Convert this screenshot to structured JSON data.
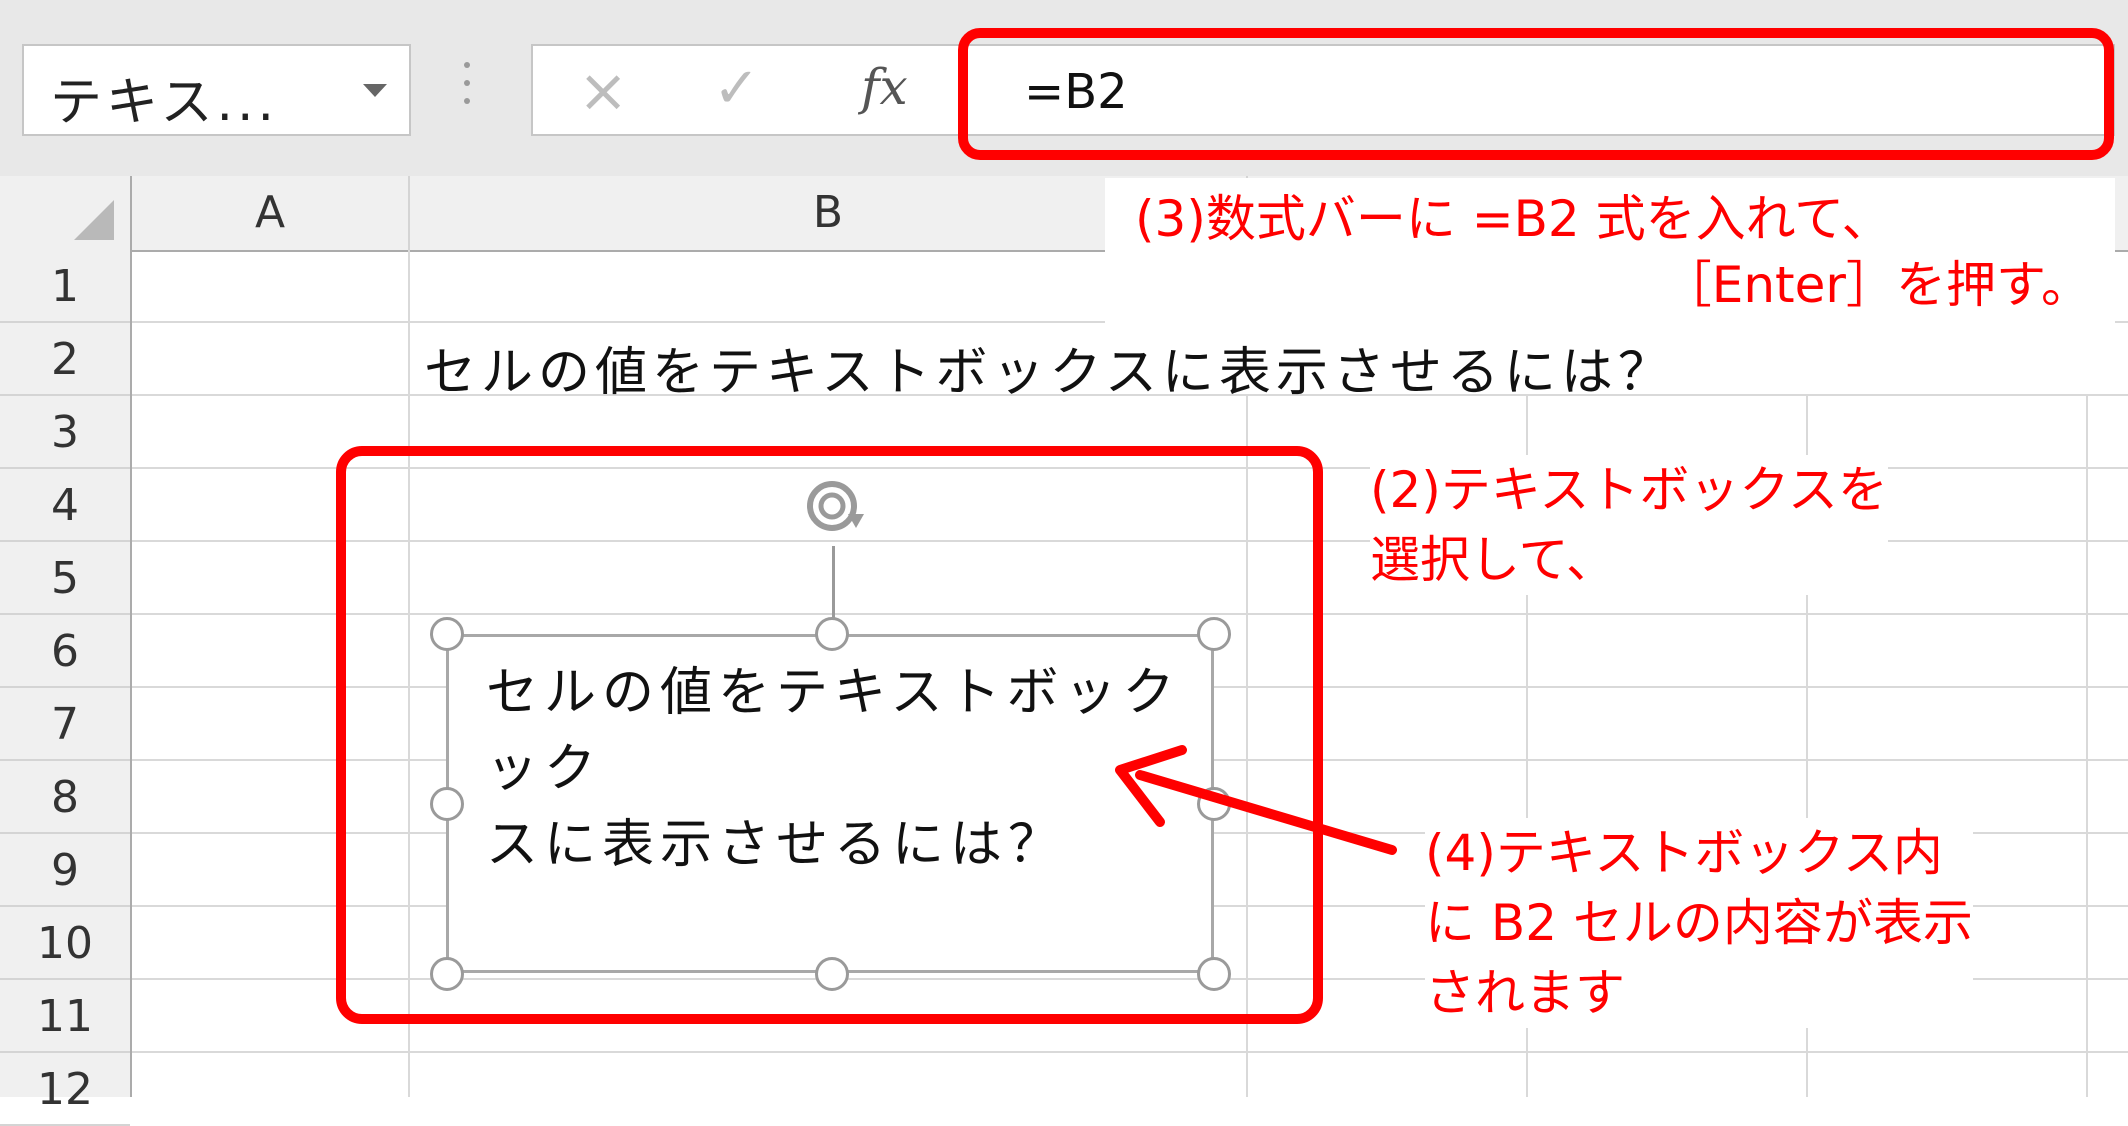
{
  "name_box": {
    "value": "テキス..."
  },
  "formula_bar": {
    "cancel_glyph": "×",
    "enter_glyph": "✓",
    "fx_label": "fx",
    "value": "=B2"
  },
  "columns": [
    "A",
    "B"
  ],
  "rows": [
    "1",
    "2",
    "3",
    "4",
    "5",
    "6",
    "7",
    "8",
    "9",
    "10",
    "11",
    "12"
  ],
  "cells": {
    "B2": "セルの値をテキストボックスに表示させるには？"
  },
  "text_box": {
    "lines": [
      "セルの値をテキストボックック",
      "スに表示させるには？"
    ]
  },
  "annotations": {
    "step3_line1": "(3)数式バーに =B2 式を入れて、",
    "step3_line2": "［Enter］を押す。",
    "step2_line1": "(2)テキストボックスを",
    "step2_line2": "選択して、",
    "step4_line1": "(4)テキストボックス内",
    "step4_line2": "に B2 セルの内容が表示",
    "step4_line3": "されます"
  },
  "colors": {
    "annotation": "#ff0000",
    "grid": "#d9d9d9",
    "header_bg": "#f0f0f0",
    "toolbar_bg": "#e8e8e8"
  }
}
